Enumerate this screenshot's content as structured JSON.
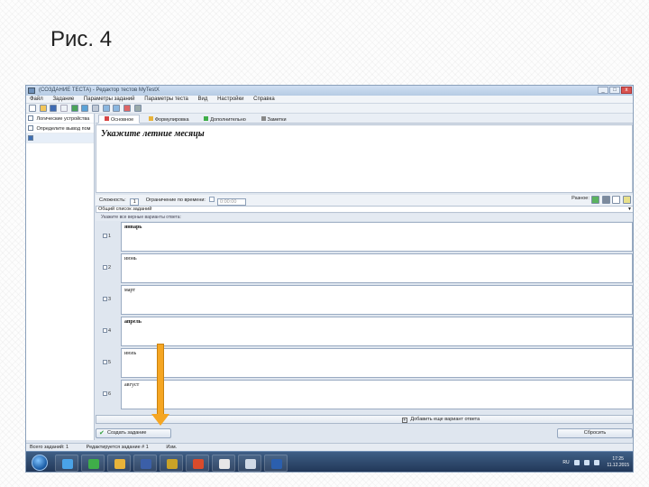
{
  "slide": {
    "title": "Рис. 4"
  },
  "window": {
    "title": "(СОЗДАНИЕ ТЕСТА) - Редактор тестов MyTestX",
    "controls": [
      "_",
      "□",
      "x"
    ],
    "menu": [
      "Файл",
      "Задание",
      "Параметры заданий",
      "Параметры теста",
      "Вид",
      "Настройки",
      "Справка"
    ],
    "left_panel": {
      "items": [
        {
          "label": "Логические устройства",
          "checked": false,
          "selected": false
        },
        {
          "label": "Определите вывод пом",
          "checked": false,
          "selected": false
        },
        {
          "label": "",
          "checked": true,
          "selected": true
        }
      ]
    },
    "tabs": [
      {
        "label": "Основное",
        "active": true
      },
      {
        "label": "Формулировка",
        "active": false
      },
      {
        "label": "Дополнительно",
        "active": false
      },
      {
        "label": "Заметки",
        "active": false
      }
    ],
    "question": {
      "text": "Укажите летние месяцы"
    },
    "options": {
      "difficulty_label": "Сложность:",
      "difficulty_value": "1",
      "time_limit_label": "Ограничение по времени:",
      "time_value": "0:00:00",
      "actions_label": "Разное:"
    },
    "group_label": "Общий список заданий",
    "hint": "Укажите все верные варианты ответа:",
    "answers": [
      {
        "marker": "1",
        "text": "январь",
        "checked": false,
        "bold": true
      },
      {
        "marker": "2",
        "text": "июнь",
        "checked": false,
        "bold": false
      },
      {
        "marker": "3",
        "text": "март",
        "checked": false,
        "bold": false
      },
      {
        "marker": "4",
        "text": "апрель",
        "checked": false,
        "bold": true
      },
      {
        "marker": "5",
        "text": "июль",
        "checked": false,
        "bold": false
      },
      {
        "marker": "6",
        "text": "август",
        "checked": false,
        "bold": false
      }
    ],
    "add_answer_label": "Добавить еще вариант ответа",
    "create_button": "Создать задание",
    "reset_button": "Сбросить",
    "status": {
      "total": "Всего заданий: 1",
      "editing": "Редактируется задание # 1",
      "type": "Изм."
    },
    "taskbar": {
      "apps": [
        {
          "name": "ie",
          "color": "#4aa3e8"
        },
        {
          "name": "torrent",
          "color": "#3fae49"
        },
        {
          "name": "chrome",
          "color": "#e8b33a"
        },
        {
          "name": "floppy",
          "color": "#3b5fa8"
        },
        {
          "name": "editor",
          "color": "#c9a227"
        },
        {
          "name": "pdf",
          "color": "#d94b2b"
        },
        {
          "name": "mail",
          "color": "#e7e7e7"
        },
        {
          "name": "chart",
          "color": "#cfd9e6"
        },
        {
          "name": "word",
          "color": "#2b5fae"
        }
      ],
      "clock_time": "17:25",
      "clock_date": "11.12.2015",
      "tray_lang": "RU"
    }
  }
}
